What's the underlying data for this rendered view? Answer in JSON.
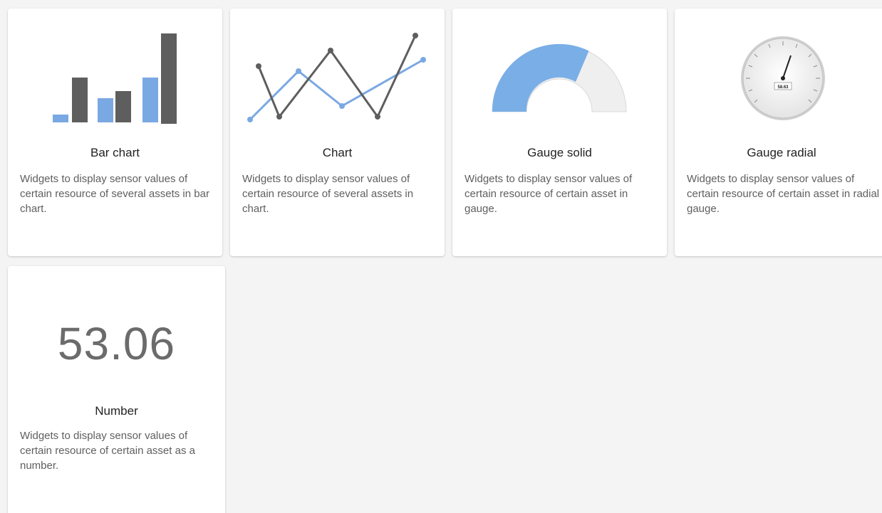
{
  "widgets": [
    {
      "title": "Bar chart",
      "description": "Widgets to display sensor values of certain resource of several assets in bar chart.",
      "icon": "bar-chart-preview"
    },
    {
      "title": "Chart",
      "description": "Widgets to display sensor values of certain resource of several assets in chart.",
      "icon": "line-chart-preview"
    },
    {
      "title": "Gauge solid",
      "description": "Widgets to display sensor values of certain resource of certain asset in gauge.",
      "icon": "solid-gauge-preview"
    },
    {
      "title": "Gauge radial",
      "description": "Widgets to display sensor values of certain resource of certain asset in radial gauge.",
      "icon": "radial-gauge-preview",
      "gauge_value": "58.63"
    },
    {
      "title": "Number",
      "description": "Widgets to display sensor values of certain resource of certain asset as a number.",
      "icon": "number-preview",
      "number_value": "53.06"
    }
  ],
  "colors": {
    "accent_blue": "#7aa8e3",
    "dark_gray": "#5e5e5e",
    "light_gray": "#ececec"
  }
}
